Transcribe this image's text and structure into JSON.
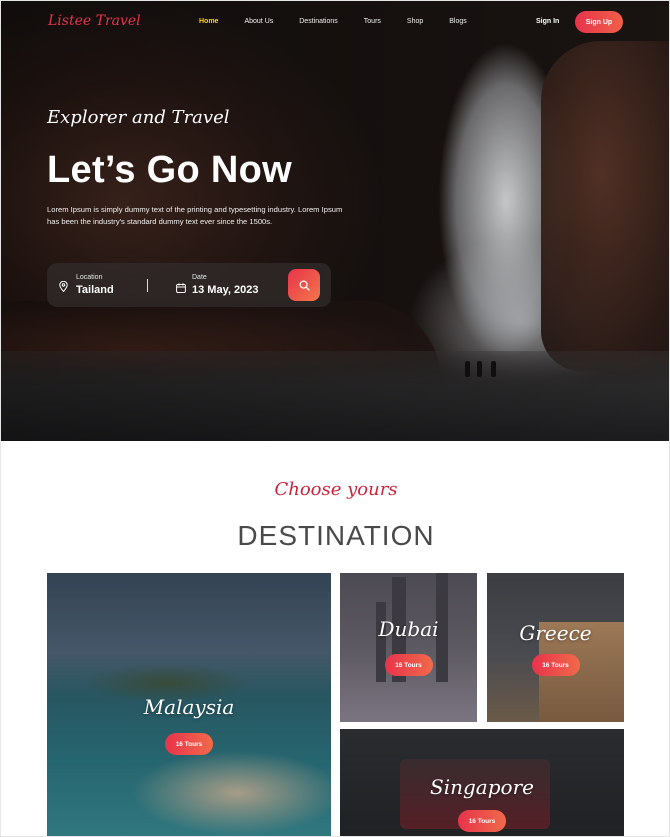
{
  "nav": {
    "logo": "Listee Travel",
    "items": [
      {
        "label": "Home",
        "active": true
      },
      {
        "label": "About Us",
        "active": false
      },
      {
        "label": "Destinations",
        "active": false
      },
      {
        "label": "Tours",
        "active": false
      },
      {
        "label": "Shop",
        "active": false
      },
      {
        "label": "Blogs",
        "active": false
      }
    ],
    "signin": "Sign In",
    "signup": "Sign Up"
  },
  "hero": {
    "tagline": "Explorer and Travel",
    "headline": "Let’s Go Now",
    "description": "Lorem Ipsum is simply dummy text of the printing and typesetting industry. Lorem Ipsum has been the industry's standard dummy text ever since the 1500s.",
    "search": {
      "location_label": "Location",
      "location_value": "Tailand",
      "date_label": "Date",
      "date_value": "13 May, 2023",
      "search_icon": "search-icon"
    }
  },
  "section": {
    "subtitle": "Choose yours",
    "title": "DESTINATION"
  },
  "destinations": [
    {
      "name": "Malaysia",
      "tours": "16 Tours"
    },
    {
      "name": "Dubai",
      "tours": "16 Tours"
    },
    {
      "name": "Greece",
      "tours": "16 Tours"
    },
    {
      "name": "Singapore",
      "tours": "16 Tours"
    }
  ],
  "colors": {
    "accent": "#e8334b",
    "nav_active": "#ffd21f",
    "title_text": "#4a4a4a"
  }
}
